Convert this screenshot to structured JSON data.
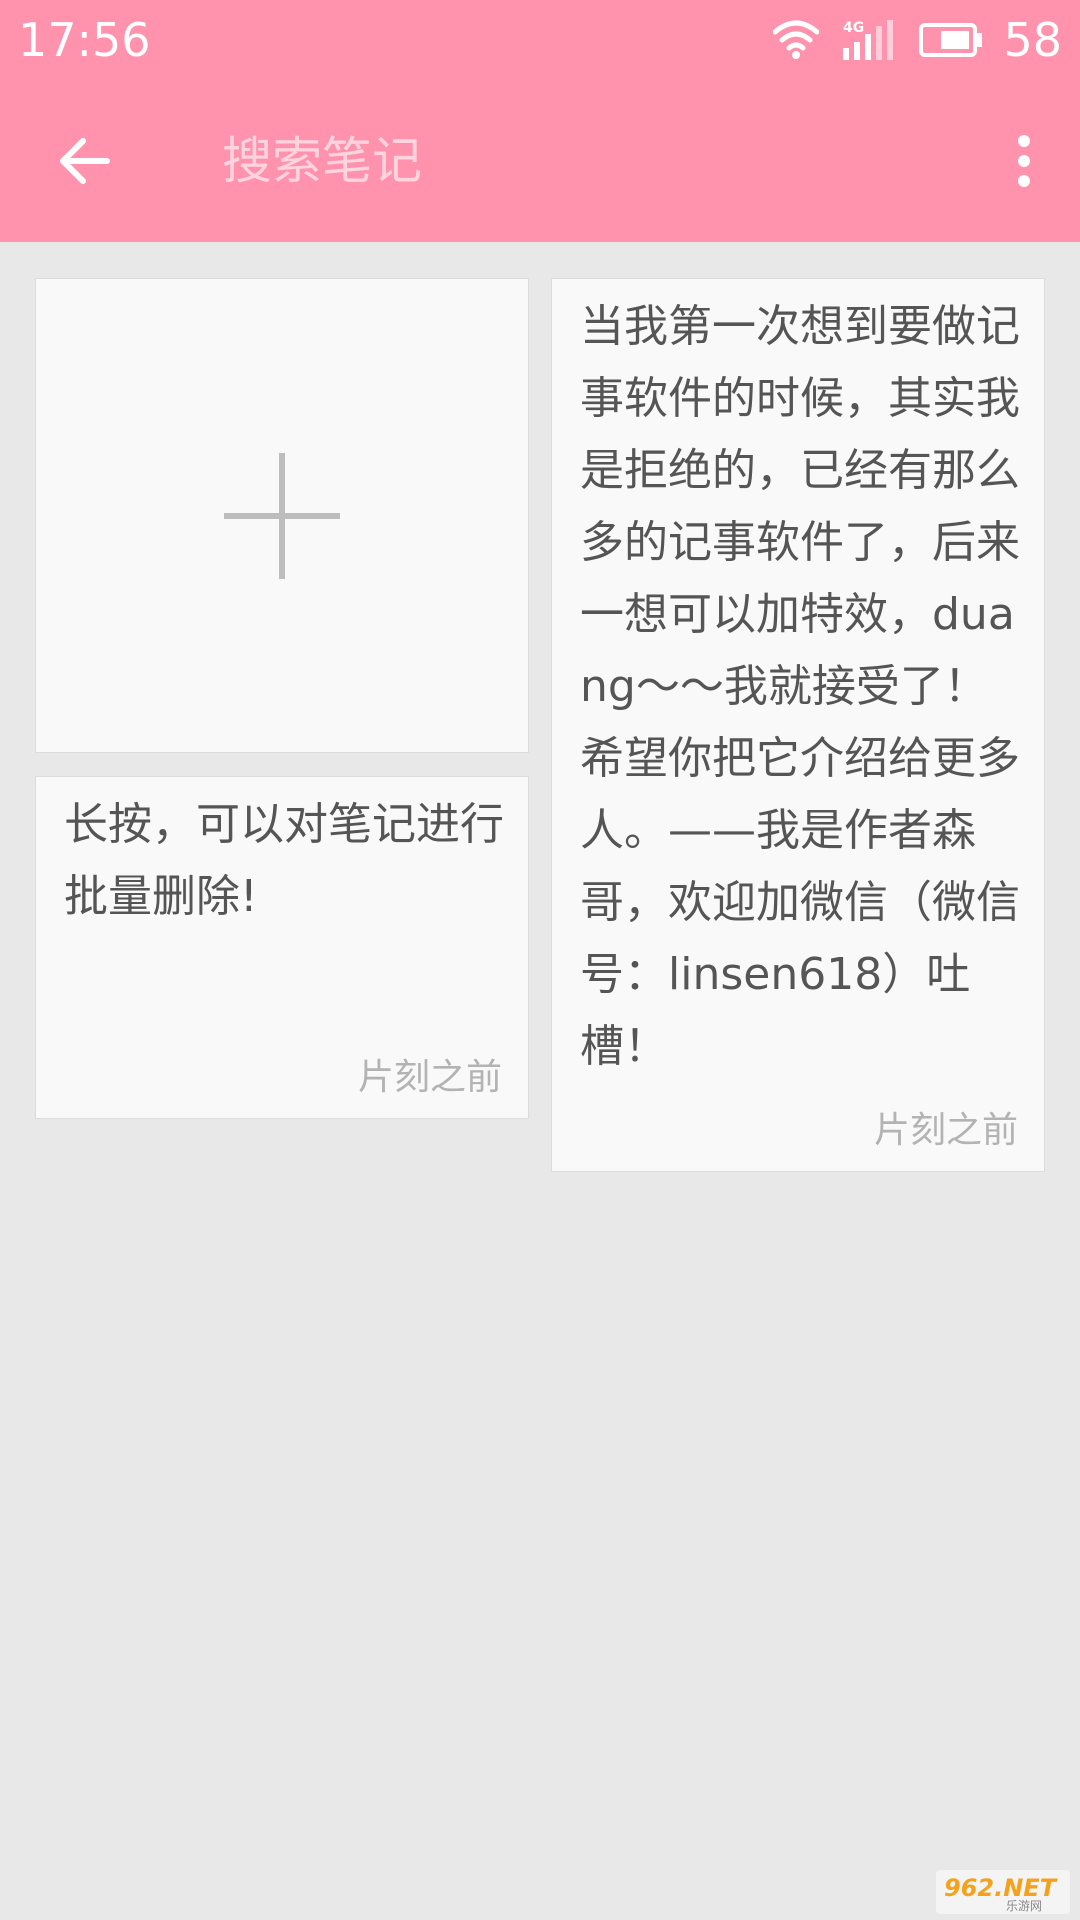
{
  "status_bar": {
    "time": "17:56",
    "network": "4G",
    "battery": "58"
  },
  "toolbar": {
    "back_icon": "arrow-left-icon",
    "search_placeholder": "搜索笔记",
    "more_icon": "more-vert-icon"
  },
  "add_note": {
    "icon": "plus-icon"
  },
  "notes": [
    {
      "text": "长按，可以对笔记进行批量删除!",
      "time": "片刻之前"
    },
    {
      "text": "当我第一次想到要做记事软件的时候，其实我是拒绝的，已经有那么多的记事软件了，后来一想可以加特效，duang～～我就接受了！希望你把它介绍给更多人。——我是作者森哥，欢迎加微信（微信号：linsen618）吐槽！",
      "time": "片刻之前"
    }
  ],
  "watermark": {
    "text": "962.NET",
    "subtext": "乐游网"
  },
  "colors": {
    "primary": "#ff93ae",
    "background": "#e8e8e8",
    "card": "#f9f9f9",
    "text": "#555555",
    "timestamp": "#b3b3b3"
  }
}
